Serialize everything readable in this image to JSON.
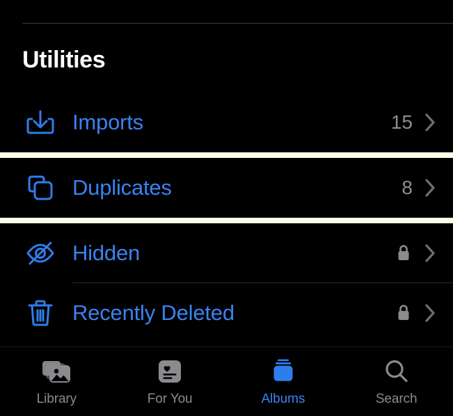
{
  "app": {
    "name": "Photos",
    "screen": "Albums"
  },
  "colors": {
    "background": "#000000",
    "accent_blue": "#3b82ef",
    "icon_blue": "#2f7deb",
    "secondary_text": "#8d8d93",
    "chevron": "#6d6d72",
    "separator": "#29292b",
    "highlight_border": "#fdfce8",
    "title_text": "#ffffff"
  },
  "section": {
    "title": "Utilities"
  },
  "list": {
    "rows": [
      {
        "label": "Imports",
        "icon": "tray-arrow-down-icon",
        "count": "15",
        "locked": false,
        "highlighted": false,
        "separator": false
      },
      {
        "label": "Duplicates",
        "icon": "duplicate-squares-icon",
        "count": "8",
        "locked": false,
        "highlighted": true,
        "separator": false
      },
      {
        "label": "Hidden",
        "icon": "eye-slash-icon",
        "count": "",
        "locked": true,
        "highlighted": false,
        "separator": true
      },
      {
        "label": "Recently Deleted",
        "icon": "trash-icon",
        "count": "",
        "locked": true,
        "highlighted": false,
        "separator": false
      }
    ],
    "lock_icon": "lock-icon",
    "chevron_icon": "chevron-right-icon"
  },
  "tabbar": {
    "tabs": [
      {
        "label": "Library",
        "icon": "photo-stack-icon",
        "active": false
      },
      {
        "label": "For You",
        "icon": "heart-card-icon",
        "active": false
      },
      {
        "label": "Albums",
        "icon": "albums-stack-icon",
        "active": true
      },
      {
        "label": "Search",
        "icon": "search-icon",
        "active": false
      }
    ]
  }
}
